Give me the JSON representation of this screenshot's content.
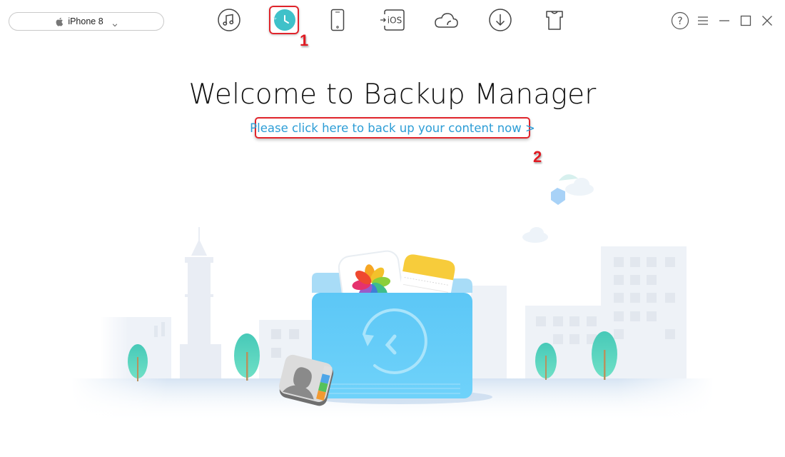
{
  "device_selector": {
    "device_name": "iPhone 8",
    "icon": "apple-logo-icon",
    "dropdown_icon": "chevron-down-icon"
  },
  "toolbar": {
    "tabs": [
      {
        "name": "audio-manager",
        "icon": "music-note-icon",
        "active": false
      },
      {
        "name": "backup-manager",
        "icon": "clock-backup-icon",
        "active": true,
        "accent": "#3fc1c9"
      },
      {
        "name": "device-manager",
        "icon": "phone-icon",
        "active": false
      },
      {
        "name": "ios-mover",
        "icon": "to-ios-icon",
        "label": "iOS",
        "active": false
      },
      {
        "name": "icloud-manager",
        "icon": "cloud-icon",
        "active": false
      },
      {
        "name": "media-downloader",
        "icon": "download-icon",
        "active": false
      },
      {
        "name": "toolkit",
        "icon": "tshirt-icon",
        "active": false
      }
    ]
  },
  "window_controls": {
    "help": "help-icon",
    "menu": "menu-icon",
    "minimize": "minimize-icon",
    "maximize": "maximize-icon",
    "close": "close-icon"
  },
  "annotations": {
    "step1": "1",
    "step2": "2",
    "highlight_color": "#e0242b"
  },
  "main": {
    "title": "Welcome to Backup Manager",
    "cta_link": "Please click here to back up your content now >",
    "link_color": "#2c9dd6"
  },
  "illustration": {
    "description": "City skyline with backup folder containing photos, notes and contacts app icons",
    "folder_color": "#5fc9f5"
  }
}
